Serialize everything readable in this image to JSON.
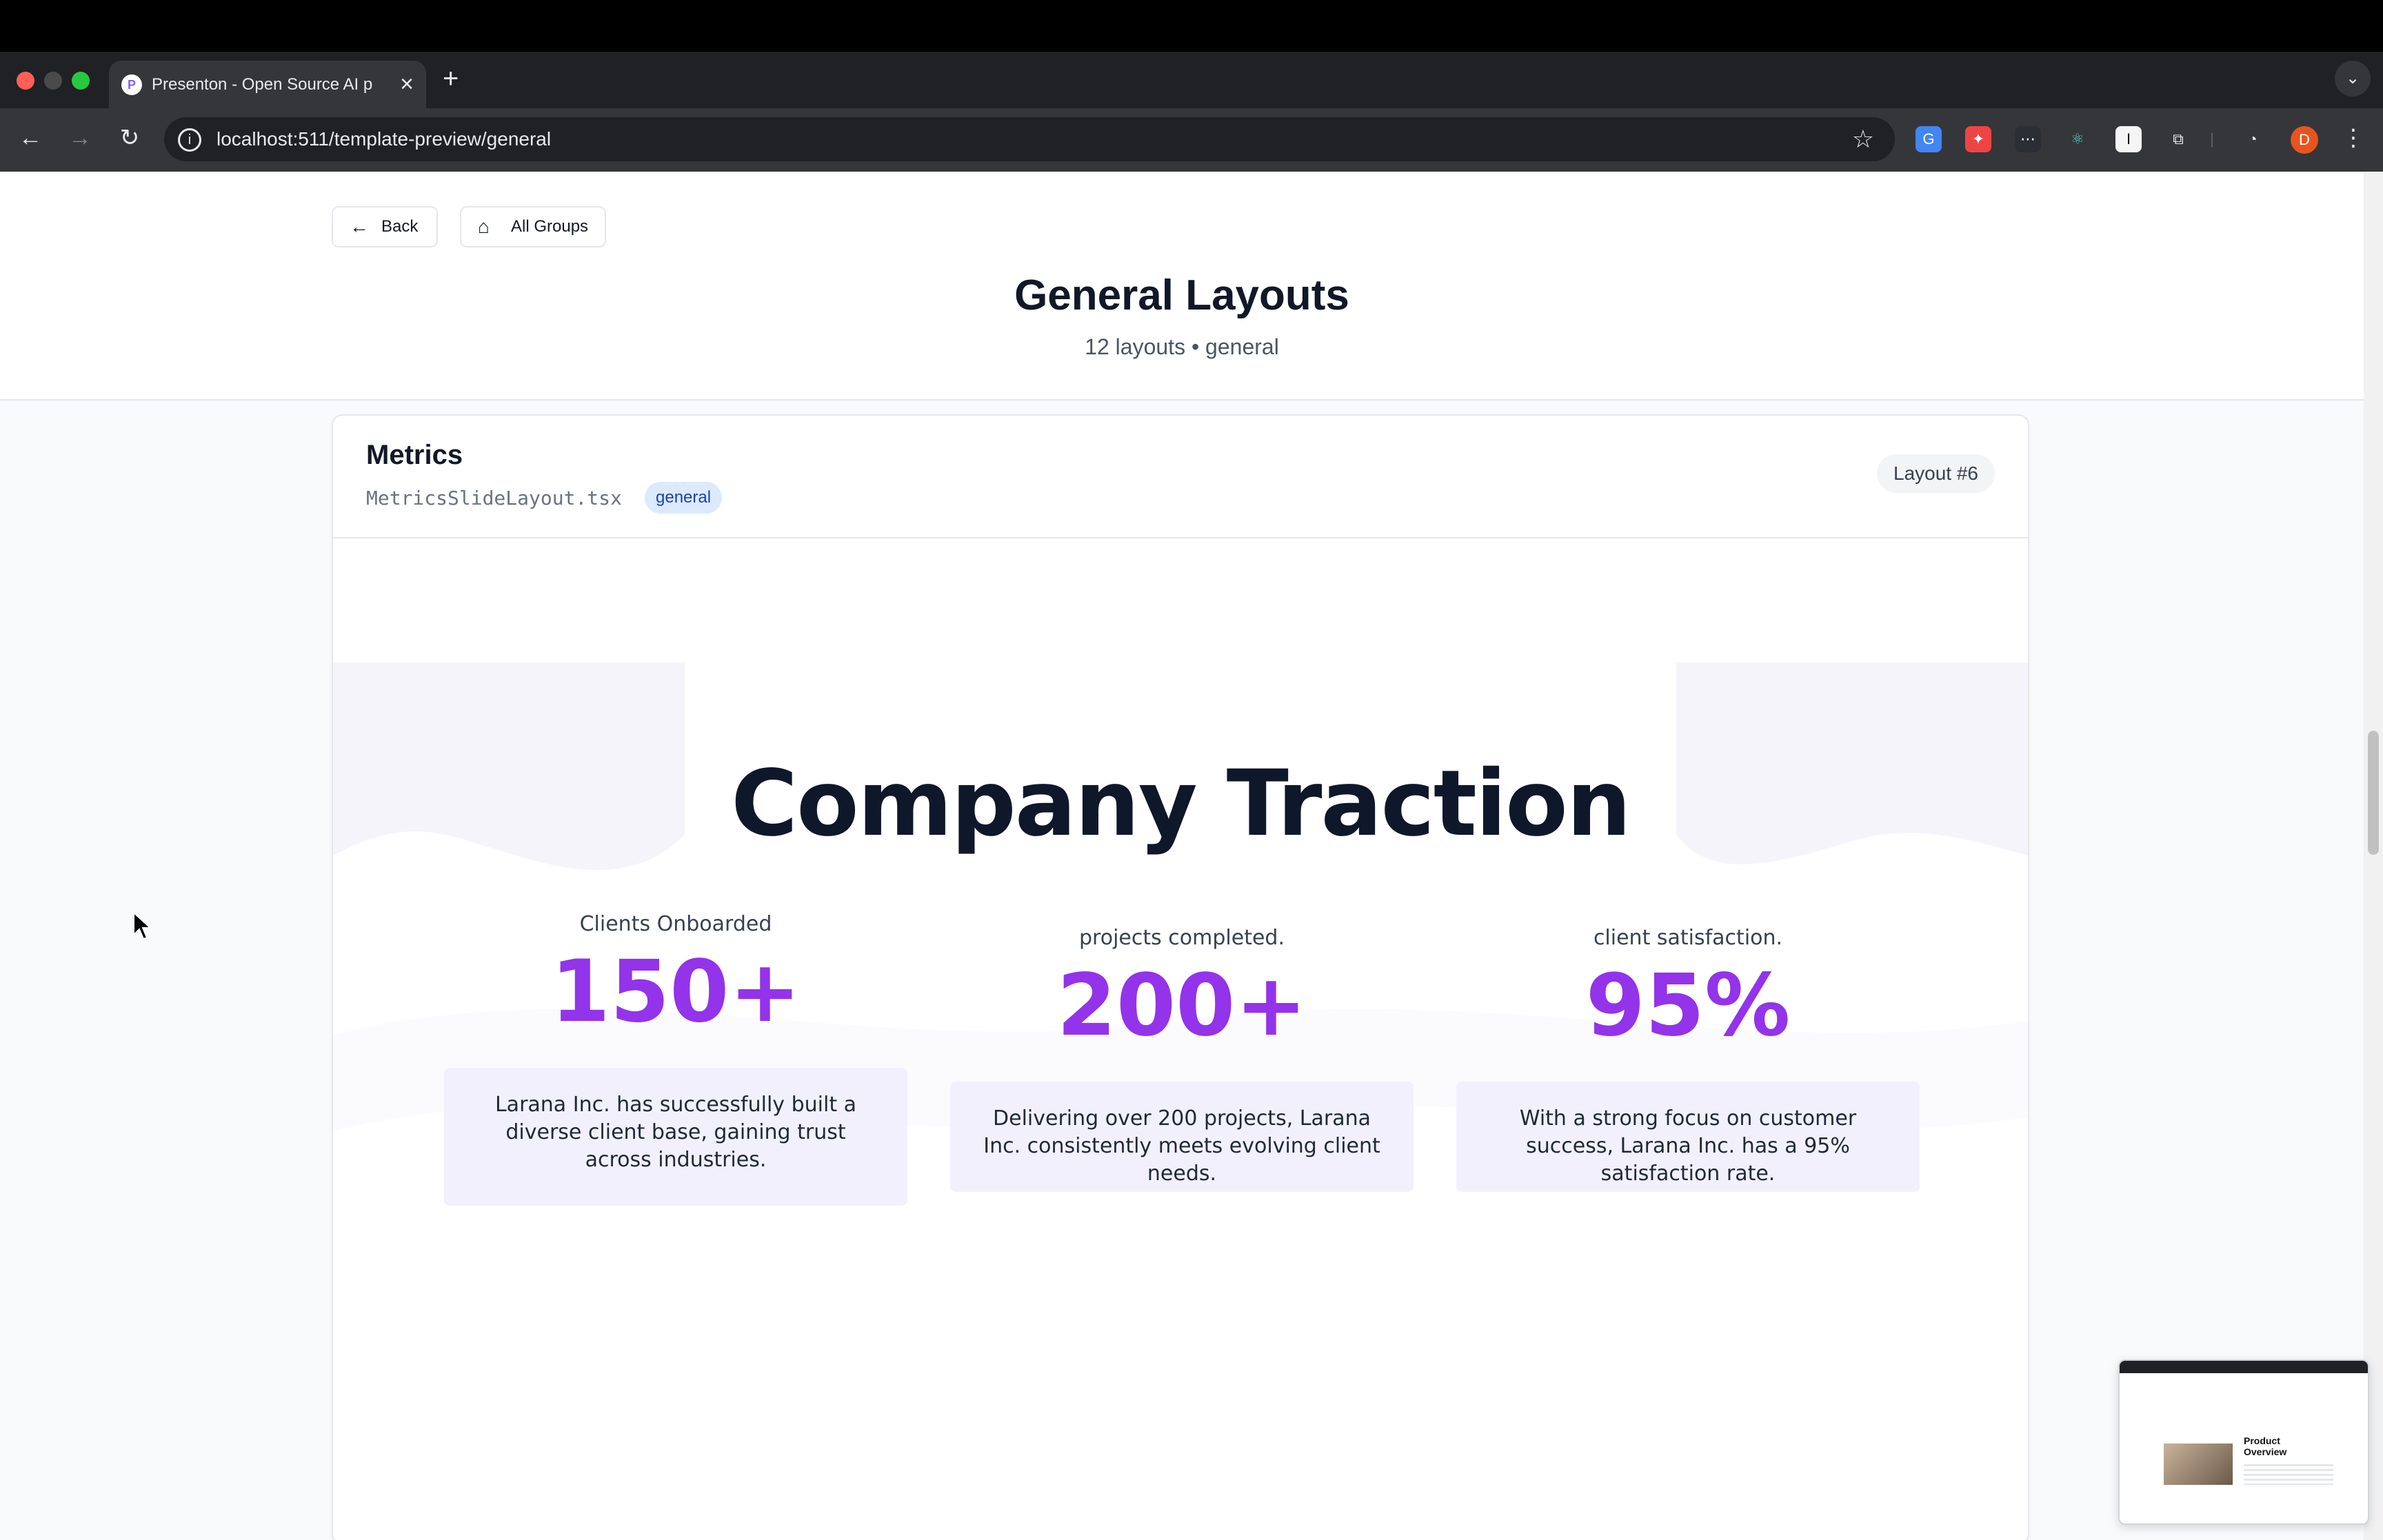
{
  "browser": {
    "tab_title": "Presenton - Open Source AI p",
    "tab_favicon": "P",
    "url": "localhost:511/template-preview/general",
    "profile_initial": "D"
  },
  "header": {
    "back_label": "Back",
    "all_groups_label": "All Groups",
    "title": "General Layouts",
    "subtitle": "12 layouts • general"
  },
  "card": {
    "title": "Metrics",
    "file": "MetricsSlideLayout.tsx",
    "tag": "general",
    "layout_number": "Layout #6"
  },
  "slide": {
    "title": "Company Traction",
    "metrics": [
      {
        "label": "Clients Onboarded",
        "value": "150+",
        "description": "Larana Inc. has successfully built a diverse client base, gaining trust across industries."
      },
      {
        "label": "projects completed.",
        "value": "200+",
        "description": "Delivering over 200 projects, Larana Inc. consistently meets evolving client needs."
      },
      {
        "label": "client satisfaction.",
        "value": "95%",
        "description": "With a strong focus on customer success, Larana Inc. has a 95% satisfaction rate."
      }
    ]
  },
  "pip_preview": {
    "title": "Product Overview"
  },
  "colors": {
    "accent": "#9333ea",
    "metric_box": "#f3f0fd",
    "tag_bg": "#dbeafe",
    "tag_text": "#1e40af"
  },
  "icons": [
    "arrow-left-icon",
    "home-icon",
    "star-icon",
    "reload-icon",
    "info-icon",
    "puzzle-icon",
    "kebab-icon",
    "close-icon",
    "plus-icon",
    "chevron-down-icon",
    "cursor-icon"
  ]
}
